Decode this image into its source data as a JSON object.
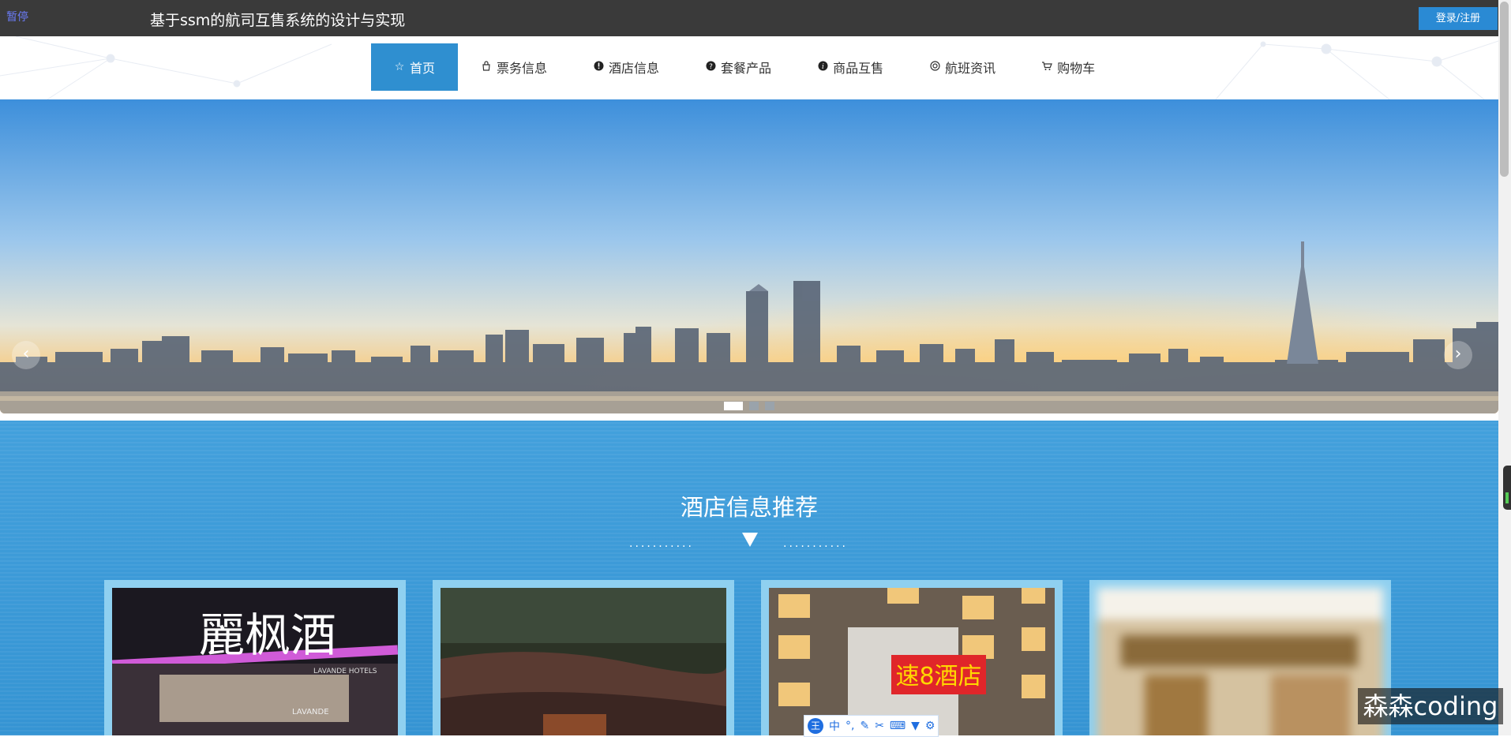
{
  "topbar": {
    "pause": "暂停",
    "title": "基于ssm的航司互售系统的设计与实现",
    "login": "登录/注册"
  },
  "nav": [
    {
      "label": "首页",
      "icon": "star-icon"
    },
    {
      "label": "票务信息",
      "icon": "bag-icon"
    },
    {
      "label": "酒店信息",
      "icon": "info-circle-icon"
    },
    {
      "label": "套餐产品",
      "icon": "question-circle-icon"
    },
    {
      "label": "商品互售",
      "icon": "info-circle-icon"
    },
    {
      "label": "航班资讯",
      "icon": "cog-icon"
    },
    {
      "label": "购物车",
      "icon": "cart-icon"
    }
  ],
  "banner": {
    "slides": 3,
    "active_slide": 1
  },
  "section": {
    "title": "酒店信息推荐",
    "hotels": [
      {
        "sign": "麗枫酒",
        "brand": "LAVANDE HOTELS",
        "sub": "LAVANDE"
      },
      {
        "sign": ""
      },
      {
        "sign": "速8酒店"
      },
      {
        "sign": ""
      }
    ]
  },
  "ime": {
    "logo": "王",
    "mode": "中"
  },
  "watermark": "森森coding",
  "colors": {
    "accent": "#2f8fd0",
    "topbar": "#3a3a3a"
  }
}
